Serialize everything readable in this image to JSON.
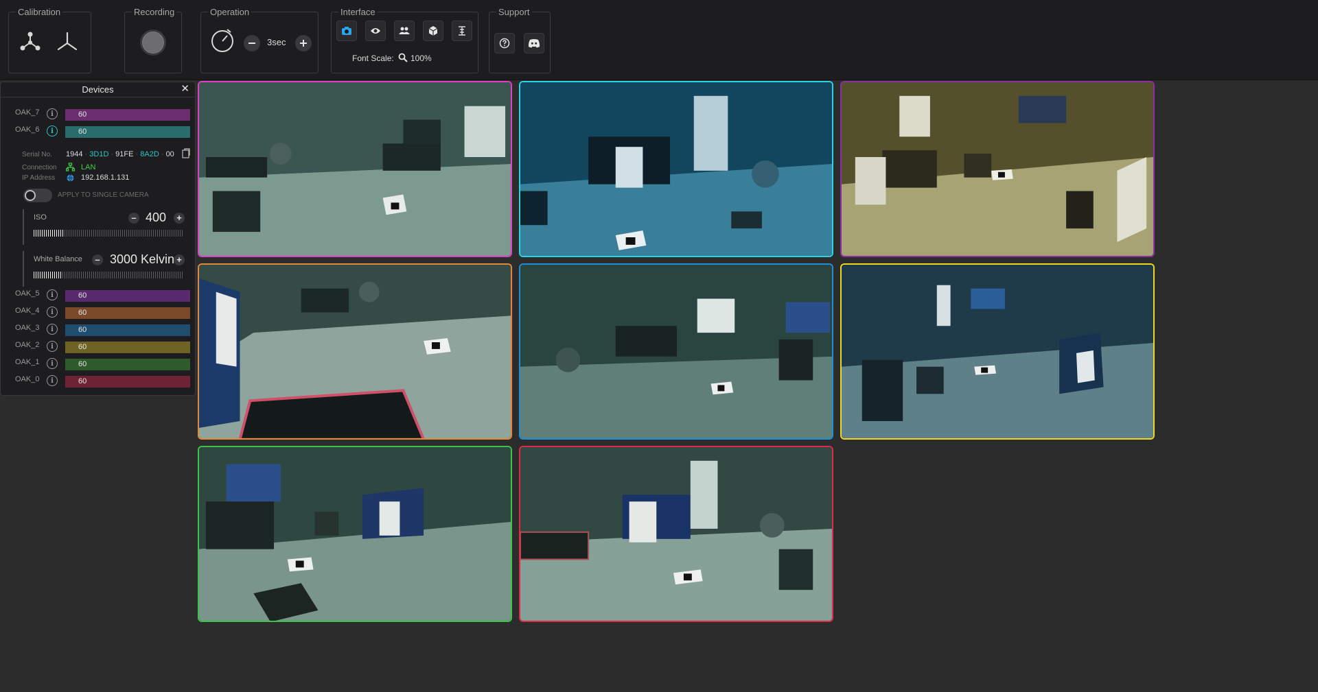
{
  "toolbar": {
    "calibration": {
      "title": "Calibration",
      "icons": [
        "calibrate-multi-icon",
        "calibrate-axis-icon"
      ]
    },
    "recording": {
      "title": "Recording",
      "icons": [
        "record-button-icon"
      ]
    },
    "operation": {
      "title": "Operation",
      "timer_value": "3sec",
      "icons": [
        "timer-icon",
        "minus-icon",
        "plus-icon"
      ]
    },
    "interface": {
      "title": "Interface",
      "font_scale_label": "Font Scale:",
      "font_scale_value": "100%",
      "icons": [
        "camera-icon",
        "eye-icon",
        "users-icon",
        "cube-icon",
        "skeleton-icon"
      ],
      "active_icon": "camera-icon"
    },
    "support": {
      "title": "Support",
      "icons": [
        "help-icon",
        "discord-icon"
      ]
    }
  },
  "devices_panel": {
    "title": "Devices",
    "close_icon": "close-icon",
    "devices": [
      {
        "name": "OAK_7",
        "value": "60",
        "color": "#6a2e6f"
      },
      {
        "name": "OAK_6",
        "value": "60",
        "color": "#2a6b6b",
        "active": true
      },
      {
        "name": "OAK_5",
        "value": "60",
        "color": "#5a2a6e"
      },
      {
        "name": "OAK_4",
        "value": "60",
        "color": "#7a4a2a"
      },
      {
        "name": "OAK_3",
        "value": "60",
        "color": "#1f4d6e"
      },
      {
        "name": "OAK_2",
        "value": "60",
        "color": "#6e6324"
      },
      {
        "name": "OAK_1",
        "value": "60",
        "color": "#2f5a2b"
      },
      {
        "name": "OAK_0",
        "value": "60",
        "color": "#6e2235"
      }
    ],
    "details": {
      "serial_label": "Serial No.",
      "serial_parts": [
        "1944",
        "3D1D",
        "91FE",
        "8A2D",
        "00"
      ],
      "serial_highlight": "#2ec4c4",
      "connection_label": "Connection",
      "connection_value": "LAN",
      "connection_color": "#3fcf4a",
      "ip_label": "IP Address",
      "ip_value": "192.168.1.131",
      "toggle_label": "APPLY TO SINGLE CAMERA",
      "toggle_on": false
    },
    "iso": {
      "label": "ISO",
      "value": "400",
      "level": 0.2
    },
    "white_balance": {
      "label": "White Balance",
      "value": "3000 Kelvin",
      "level": 0.19
    }
  },
  "cameras": [
    {
      "color": "#e040c8"
    },
    {
      "color": "#2bd4e6"
    },
    {
      "color": "#8e2ea6"
    },
    {
      "color": "#e08a3a"
    },
    {
      "color": "#1f8fd6"
    },
    {
      "color": "#f0d820"
    },
    {
      "color": "#3cc44a"
    },
    {
      "color": "#e02a4a"
    }
  ]
}
